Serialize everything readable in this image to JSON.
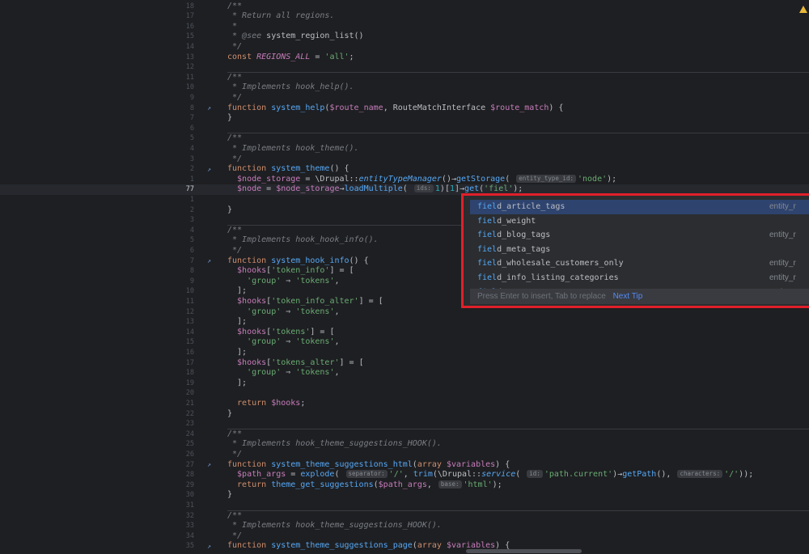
{
  "lines": [
    {
      "num": "18",
      "segs": [
        [
          "com",
          "/**"
        ]
      ]
    },
    {
      "num": "17",
      "segs": [
        [
          "com",
          " * Return all regions."
        ]
      ]
    },
    {
      "num": "16",
      "segs": [
        [
          "com",
          " *"
        ]
      ]
    },
    {
      "num": "15",
      "segs": [
        [
          "com",
          " * @see "
        ],
        [
          "cls",
          "system_region_list()"
        ]
      ]
    },
    {
      "num": "14",
      "segs": [
        [
          "com",
          " */"
        ]
      ]
    },
    {
      "num": "13",
      "segs": [
        [
          "kw",
          "const "
        ],
        [
          "const",
          "REGIONS_ALL"
        ],
        [
          "cls",
          " = "
        ],
        [
          "str",
          "'all'"
        ],
        [
          "cls",
          ";"
        ]
      ]
    },
    {
      "num": "12",
      "segs": []
    },
    {
      "num": "11",
      "segs": [
        [
          "com",
          "/**"
        ]
      ],
      "sepBefore": true
    },
    {
      "num": "10",
      "segs": [
        [
          "com",
          " * Implements hook_help()."
        ]
      ]
    },
    {
      "num": "9",
      "segs": [
        [
          "com",
          " */"
        ]
      ]
    },
    {
      "num": "8",
      "icon": true,
      "segs": [
        [
          "kw",
          "function "
        ],
        [
          "fn",
          "system_help"
        ],
        [
          "cls",
          "("
        ],
        [
          "var",
          "$route_name"
        ],
        [
          "cls",
          ", RouteMatchInterface "
        ],
        [
          "var",
          "$route_match"
        ],
        [
          "cls",
          ") {"
        ]
      ]
    },
    {
      "num": "7",
      "segs": [
        [
          "cls",
          "}"
        ]
      ]
    },
    {
      "num": "6",
      "segs": []
    },
    {
      "num": "5",
      "segs": [
        [
          "com",
          "/**"
        ]
      ],
      "sepBefore": true
    },
    {
      "num": "4",
      "segs": [
        [
          "com",
          " * Implements hook_theme()."
        ]
      ]
    },
    {
      "num": "3",
      "segs": [
        [
          "com",
          " */"
        ]
      ]
    },
    {
      "num": "2",
      "icon": true,
      "segs": [
        [
          "kw",
          "function "
        ],
        [
          "fn",
          "system_theme"
        ],
        [
          "cls",
          "() {"
        ]
      ]
    },
    {
      "num": "1",
      "segs": [
        [
          "var",
          "  $node_storage"
        ],
        [
          "cls",
          " = \\Drupal::"
        ],
        [
          "it",
          "entityTypeManager"
        ],
        [
          "cls",
          "()→"
        ],
        [
          "fn",
          "getStorage"
        ],
        [
          "cls",
          "( "
        ],
        [
          "hint",
          "entity_type_id:"
        ],
        [
          "str",
          "'node'"
        ],
        [
          "cls",
          ");"
        ]
      ]
    },
    {
      "num": "77",
      "current": true,
      "segs": [
        [
          "var",
          "  $node"
        ],
        [
          "cls",
          " = "
        ],
        [
          "var",
          "$node_storage"
        ],
        [
          "cls",
          "→"
        ],
        [
          "fn",
          "loadMultiple"
        ],
        [
          "cls",
          "( "
        ],
        [
          "hint",
          "ids:"
        ],
        [
          "num",
          "1"
        ],
        [
          "cls",
          ")["
        ],
        [
          "num",
          "1"
        ],
        [
          "cls",
          "]→"
        ],
        [
          "fn",
          "get"
        ],
        [
          "cls",
          "("
        ],
        [
          "str",
          "'fiel'"
        ],
        [
          "cls",
          ");"
        ]
      ]
    },
    {
      "num": "1",
      "segs": []
    },
    {
      "num": "2",
      "segs": [
        [
          "cls",
          "}"
        ]
      ]
    },
    {
      "num": "3",
      "segs": []
    },
    {
      "num": "4",
      "segs": [
        [
          "com",
          "/**"
        ]
      ],
      "sepBefore": true
    },
    {
      "num": "5",
      "segs": [
        [
          "com",
          " * Implements hook_hook_info()."
        ]
      ]
    },
    {
      "num": "6",
      "segs": [
        [
          "com",
          " */"
        ]
      ]
    },
    {
      "num": "7",
      "icon": true,
      "segs": [
        [
          "kw",
          "function "
        ],
        [
          "fn",
          "system_hook_info"
        ],
        [
          "cls",
          "() {"
        ]
      ]
    },
    {
      "num": "8",
      "segs": [
        [
          "var",
          "  $hooks"
        ],
        [
          "cls",
          "["
        ],
        [
          "str",
          "'token_info'"
        ],
        [
          "cls",
          "] = ["
        ]
      ]
    },
    {
      "num": "9",
      "segs": [
        [
          "cls",
          "    "
        ],
        [
          "str",
          "'group'"
        ],
        [
          "cls",
          " ⇒ "
        ],
        [
          "str",
          "'tokens'"
        ],
        [
          "cls",
          ","
        ]
      ]
    },
    {
      "num": "10",
      "segs": [
        [
          "cls",
          "  ];"
        ]
      ]
    },
    {
      "num": "11",
      "segs": [
        [
          "var",
          "  $hooks"
        ],
        [
          "cls",
          "["
        ],
        [
          "str",
          "'token_info_alter'"
        ],
        [
          "cls",
          "] = ["
        ]
      ]
    },
    {
      "num": "12",
      "segs": [
        [
          "cls",
          "    "
        ],
        [
          "str",
          "'group'"
        ],
        [
          "cls",
          " ⇒ "
        ],
        [
          "str",
          "'tokens'"
        ],
        [
          "cls",
          ","
        ]
      ]
    },
    {
      "num": "13",
      "segs": [
        [
          "cls",
          "  ];"
        ]
      ]
    },
    {
      "num": "14",
      "segs": [
        [
          "var",
          "  $hooks"
        ],
        [
          "cls",
          "["
        ],
        [
          "str",
          "'tokens'"
        ],
        [
          "cls",
          "] = ["
        ]
      ]
    },
    {
      "num": "15",
      "segs": [
        [
          "cls",
          "    "
        ],
        [
          "str",
          "'group'"
        ],
        [
          "cls",
          " ⇒ "
        ],
        [
          "str",
          "'tokens'"
        ],
        [
          "cls",
          ","
        ]
      ]
    },
    {
      "num": "16",
      "segs": [
        [
          "cls",
          "  ];"
        ]
      ]
    },
    {
      "num": "17",
      "segs": [
        [
          "var",
          "  $hooks"
        ],
        [
          "cls",
          "["
        ],
        [
          "str",
          "'tokens_alter'"
        ],
        [
          "cls",
          "] = ["
        ]
      ]
    },
    {
      "num": "18",
      "segs": [
        [
          "cls",
          "    "
        ],
        [
          "str",
          "'group'"
        ],
        [
          "cls",
          " ⇒ "
        ],
        [
          "str",
          "'tokens'"
        ],
        [
          "cls",
          ","
        ]
      ]
    },
    {
      "num": "19",
      "segs": [
        [
          "cls",
          "  ];"
        ]
      ]
    },
    {
      "num": "20",
      "segs": []
    },
    {
      "num": "21",
      "segs": [
        [
          "kw",
          "  return "
        ],
        [
          "var",
          "$hooks"
        ],
        [
          "cls",
          ";"
        ]
      ]
    },
    {
      "num": "22",
      "segs": [
        [
          "cls",
          "}"
        ]
      ]
    },
    {
      "num": "23",
      "segs": []
    },
    {
      "num": "24",
      "segs": [
        [
          "com",
          "/**"
        ]
      ],
      "sepBefore": true
    },
    {
      "num": "25",
      "segs": [
        [
          "com",
          " * Implements hook_theme_suggestions_HOOK()."
        ]
      ]
    },
    {
      "num": "26",
      "segs": [
        [
          "com",
          " */"
        ]
      ]
    },
    {
      "num": "27",
      "icon": true,
      "segs": [
        [
          "kw",
          "function "
        ],
        [
          "fn",
          "system_theme_suggestions_html"
        ],
        [
          "cls",
          "("
        ],
        [
          "kw",
          "array "
        ],
        [
          "var",
          "$variables"
        ],
        [
          "cls",
          ") {"
        ]
      ]
    },
    {
      "num": "28",
      "segs": [
        [
          "var",
          "  $path_args"
        ],
        [
          "cls",
          " = "
        ],
        [
          "fn",
          "explode"
        ],
        [
          "cls",
          "( "
        ],
        [
          "hint",
          "separator:"
        ],
        [
          "str",
          "'/'"
        ],
        [
          "cls",
          ", "
        ],
        [
          "fn",
          "trim"
        ],
        [
          "cls",
          "(\\Drupal::"
        ],
        [
          "it",
          "service"
        ],
        [
          "cls",
          "( "
        ],
        [
          "hint",
          "id:"
        ],
        [
          "str",
          "'path.current'"
        ],
        [
          "cls",
          ")→"
        ],
        [
          "fn",
          "getPath"
        ],
        [
          "cls",
          "(), "
        ],
        [
          "hint",
          "characters:"
        ],
        [
          "str",
          "'/'"
        ],
        [
          "cls",
          "));"
        ]
      ]
    },
    {
      "num": "29",
      "segs": [
        [
          "kw",
          "  return "
        ],
        [
          "fn",
          "theme_get_suggestions"
        ],
        [
          "cls",
          "("
        ],
        [
          "var",
          "$path_args"
        ],
        [
          "cls",
          ", "
        ],
        [
          "hint",
          "base:"
        ],
        [
          "str",
          "'html'"
        ],
        [
          "cls",
          ");"
        ]
      ]
    },
    {
      "num": "30",
      "segs": [
        [
          "cls",
          "}"
        ]
      ]
    },
    {
      "num": "31",
      "segs": []
    },
    {
      "num": "32",
      "segs": [
        [
          "com",
          "/**"
        ]
      ],
      "sepBefore": true
    },
    {
      "num": "33",
      "segs": [
        [
          "com",
          " * Implements hook_theme_suggestions_HOOK()."
        ]
      ]
    },
    {
      "num": "34",
      "segs": [
        [
          "com",
          " */"
        ]
      ]
    },
    {
      "num": "35",
      "icon": true,
      "segs": [
        [
          "kw",
          "function "
        ],
        [
          "fn",
          "system_theme_suggestions_page"
        ],
        [
          "cls",
          "("
        ],
        [
          "kw",
          "array "
        ],
        [
          "var",
          "$variables"
        ],
        [
          "cls",
          ") {"
        ]
      ]
    }
  ],
  "completion": {
    "typed": "fiel",
    "items": [
      {
        "match": "fiel",
        "rest": "d_article_tags",
        "type": "entity_r"
      },
      {
        "match": "fiel",
        "rest": "d_weight",
        "type": ""
      },
      {
        "match": "fiel",
        "rest": "d_blog_tags",
        "type": "entity_r"
      },
      {
        "match": "fiel",
        "rest": "d_meta_tags",
        "type": ""
      },
      {
        "match": "fiel",
        "rest": "d_wholesale_customers_only",
        "type": "entity_r"
      },
      {
        "match": "fiel",
        "rest": "d_info_listing_categories",
        "type": "entity_r"
      },
      {
        "match": "fiel",
        "rest": "d_tags",
        "type": "entity_r"
      }
    ],
    "footer_text": "Press Enter to insert, Tab to replace",
    "footer_tip": "Next Tip"
  },
  "colors": {
    "accent_border": "#e0202a",
    "selection": "#2e436e"
  }
}
